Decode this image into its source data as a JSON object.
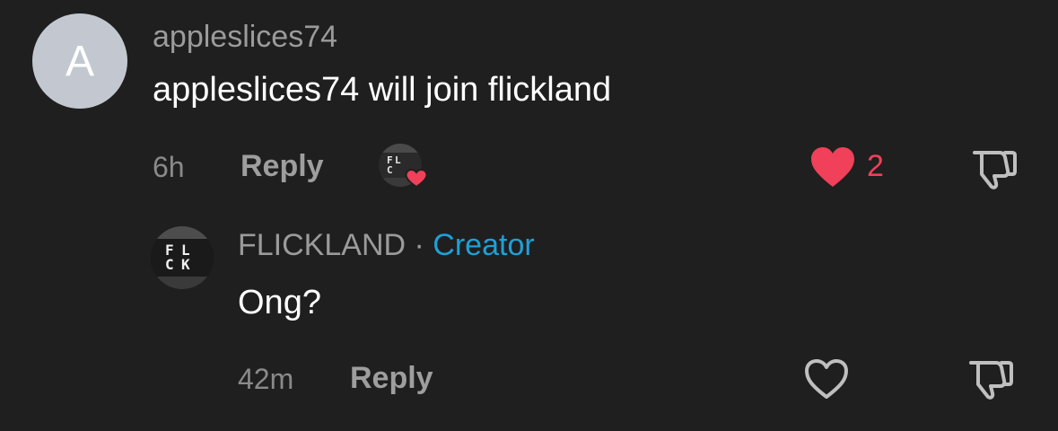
{
  "comment": {
    "avatar_letter": "A",
    "username": "appleslices74",
    "text": "appleslices74 will join flickland",
    "time": "6h",
    "reply_label": "Reply",
    "creator_liked_avatar": "FLCK",
    "likes": "2",
    "liked": true
  },
  "reply": {
    "avatar_text": "FLCK",
    "username": "FLICKLAND",
    "separator": "·",
    "badge": "Creator",
    "text": "Ong?",
    "time": "42m",
    "reply_label": "Reply",
    "liked": false
  },
  "colors": {
    "background": "#1f1f1f",
    "like_active": "#f0405a",
    "creator_badge": "#1fa0d6"
  }
}
